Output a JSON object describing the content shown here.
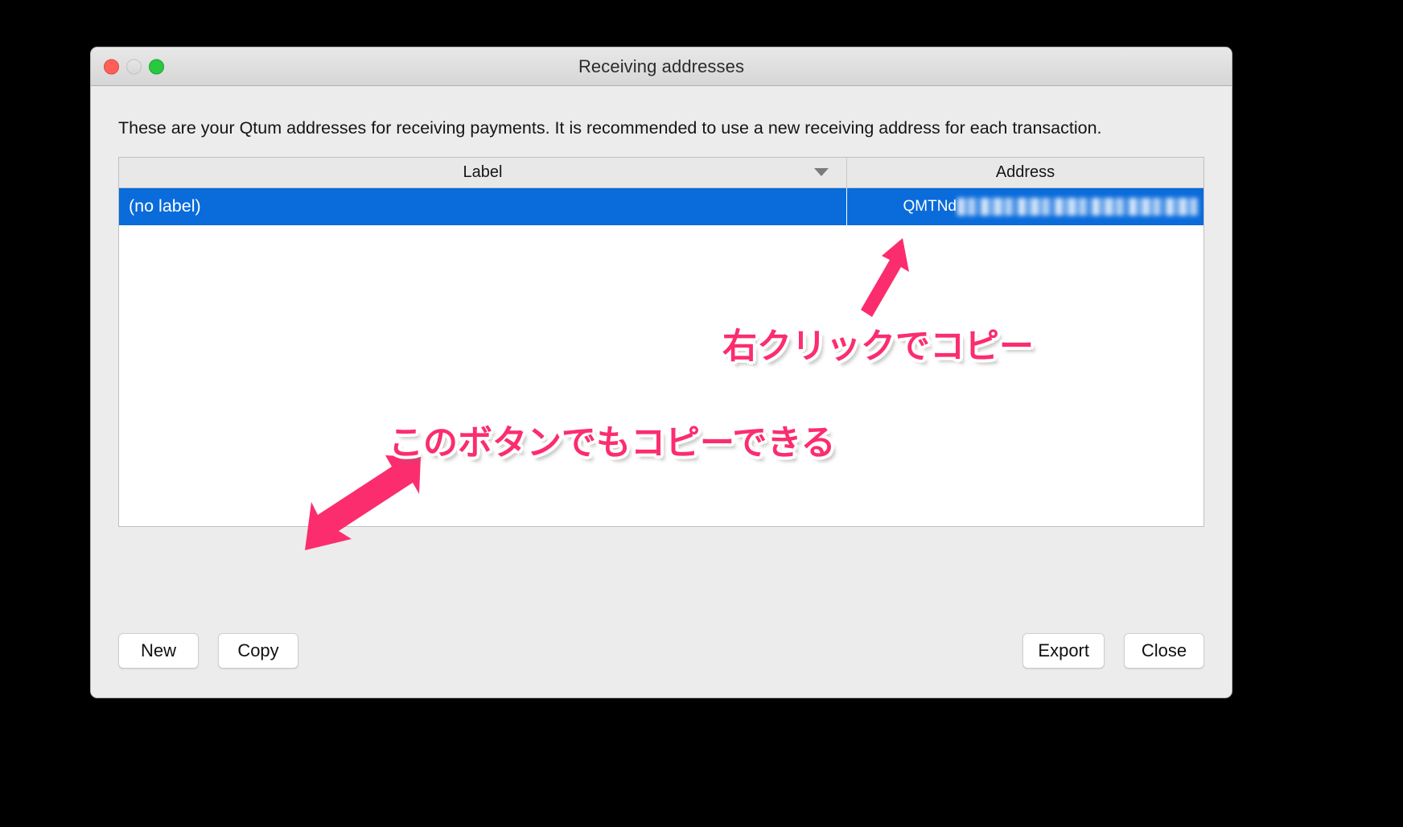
{
  "window": {
    "title": "Receiving addresses",
    "controls": [
      {
        "name": "close",
        "color": "#ff5f57"
      },
      {
        "name": "minimize",
        "color": "#dedede"
      },
      {
        "name": "zoom",
        "color": "#28c840"
      }
    ]
  },
  "intro": {
    "text": "These are your Qtum addresses for receiving payments. It is recommended to use a new receiving address for each transaction."
  },
  "table": {
    "columns": [
      {
        "key": "label",
        "header": "Label",
        "sorted": true,
        "sort_direction": "descending"
      },
      {
        "key": "address",
        "header": "Address",
        "sorted": false
      }
    ],
    "rows": [
      {
        "label": "(no label)",
        "address_visible_prefix": "QMTNd",
        "address_redacted": true,
        "selected": true
      }
    ],
    "selection_color": "#0a6bdb"
  },
  "buttons": {
    "new": "New",
    "copy": "Copy",
    "export": "Export",
    "close": "Close"
  },
  "annotations": [
    {
      "id": "right-click",
      "text": "右クリックでコピー",
      "color": "#fb2d6e"
    },
    {
      "id": "button-copy",
      "text": "このボタンでもコピーできる",
      "color": "#fb2d6e"
    }
  ],
  "arrows": [
    {
      "id": "arrow-to-address",
      "color": "#fb2d6e",
      "points_to": "address-cell"
    },
    {
      "id": "arrow-to-copy-button",
      "color": "#fb2d6e",
      "points_to": "copy-button"
    }
  ]
}
